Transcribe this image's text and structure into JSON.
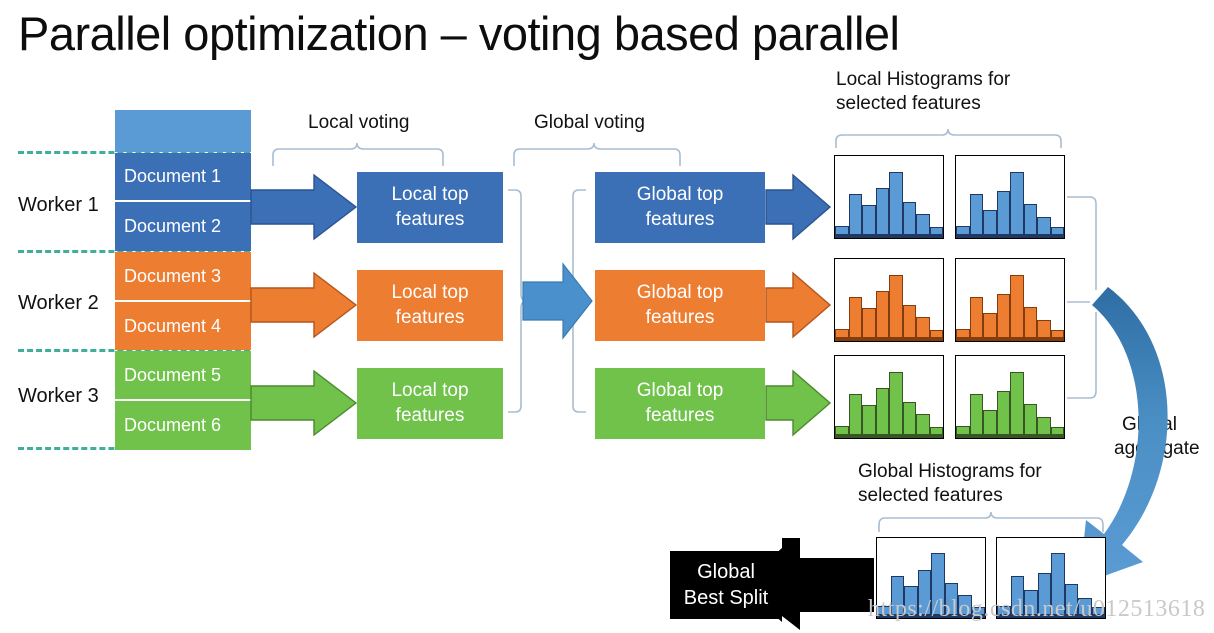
{
  "title": "Parallel optimization – voting based parallel",
  "workers": [
    {
      "label": "Worker 1",
      "color": "#3b6fb6",
      "docs": [
        "Document 1",
        "Document 2"
      ]
    },
    {
      "label": "Worker 2",
      "color": "#ed7d31",
      "docs": [
        "Document 3",
        "Document 4"
      ]
    },
    {
      "label": "Worker 3",
      "color": "#70c24a",
      "docs": [
        "Document 5",
        "Document 6"
      ]
    }
  ],
  "data_header": {
    "color": "#5b9bd5"
  },
  "captions": {
    "local_voting": "Local voting",
    "global_voting": "Global voting",
    "local_hist_line1": "Local Histograms for",
    "local_hist_line2": "selected features",
    "global_hist_line1": "Global Histograms for",
    "global_hist_line2": "selected features",
    "global_aggregate_line1": "Global",
    "global_aggregate_line2": "aggregate"
  },
  "local_boxes": [
    {
      "line1": "Local top",
      "line2": "features",
      "color": "#3b6fb6"
    },
    {
      "line1": "Local top",
      "line2": "features",
      "color": "#ed7d31"
    },
    {
      "line1": "Local top",
      "line2": "features",
      "color": "#70c24a"
    }
  ],
  "global_boxes": [
    {
      "line1": "Global top",
      "line2": "features",
      "color": "#3b6fb6"
    },
    {
      "line1": "Global top",
      "line2": "features",
      "color": "#ed7d31"
    },
    {
      "line1": "Global top",
      "line2": "features",
      "color": "#70c24a"
    }
  ],
  "best_split": {
    "line1": "Global",
    "line2": "Best Split",
    "background": "#000000",
    "text_color": "#ffffff"
  },
  "watermark": "https://blog.csdn.net/u012513618",
  "palette": {
    "blue": "#3b6fb6",
    "light_blue": "#5b9bd5",
    "orange": "#ed7d31",
    "green": "#70c24a",
    "teal_dash": "#3fae9b",
    "connector": "#a9bdd0",
    "black": "#000000"
  },
  "chart_data": {
    "type": "bar",
    "title": "Histograms for selected features",
    "xlabel": "",
    "ylabel": "",
    "ylim": [
      0,
      1
    ],
    "grid": false,
    "legend": "none",
    "bins": 8,
    "series": [
      {
        "name": "Local histogram A (Worker 1, blue)",
        "color": "#5b9bd5",
        "values": [
          0.15,
          0.56,
          0.42,
          0.64,
          0.86,
          0.46,
          0.3,
          0.13
        ]
      },
      {
        "name": "Local histogram B (Worker 1, blue)",
        "color": "#5b9bd5",
        "values": [
          0.15,
          0.56,
          0.36,
          0.6,
          0.86,
          0.44,
          0.26,
          0.13
        ]
      },
      {
        "name": "Local histogram A (Worker 2, orange)",
        "color": "#ed7d31",
        "values": [
          0.15,
          0.56,
          0.42,
          0.64,
          0.86,
          0.46,
          0.3,
          0.13
        ]
      },
      {
        "name": "Local histogram B (Worker 2, orange)",
        "color": "#ed7d31",
        "values": [
          0.15,
          0.56,
          0.36,
          0.6,
          0.86,
          0.44,
          0.26,
          0.13
        ]
      },
      {
        "name": "Local histogram A (Worker 3, green)",
        "color": "#70c24a",
        "values": [
          0.15,
          0.56,
          0.42,
          0.64,
          0.86,
          0.46,
          0.3,
          0.13
        ]
      },
      {
        "name": "Local histogram B (Worker 3, green)",
        "color": "#70c24a",
        "values": [
          0.15,
          0.56,
          0.36,
          0.6,
          0.86,
          0.44,
          0.26,
          0.13
        ]
      },
      {
        "name": "Global histogram A",
        "color": "#5b9bd5",
        "values": [
          0.15,
          0.56,
          0.42,
          0.64,
          0.86,
          0.46,
          0.3,
          0.13
        ]
      },
      {
        "name": "Global histogram B",
        "color": "#5b9bd5",
        "values": [
          0.15,
          0.56,
          0.36,
          0.6,
          0.86,
          0.44,
          0.26,
          0.13
        ]
      }
    ]
  }
}
